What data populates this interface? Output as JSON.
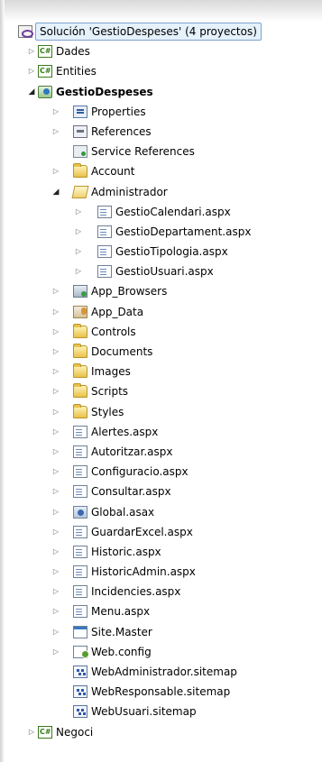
{
  "solution": {
    "label": "Solución 'GestioDespeses'  (4 proyectos)",
    "icon": "solution-icon"
  },
  "tree": [
    {
      "id": "dades",
      "label": "Dades",
      "level": 0,
      "arrow": "collapsed",
      "icon": "csharp-project-icon",
      "kind": "cs"
    },
    {
      "id": "entities",
      "label": "Entities",
      "level": 0,
      "arrow": "collapsed",
      "icon": "csharp-project-icon",
      "kind": "cs"
    },
    {
      "id": "gestiodespeses",
      "label": "GestioDespeses",
      "level": 0,
      "arrow": "expanded",
      "icon": "web-project-icon",
      "kind": "web",
      "bold": true
    },
    {
      "id": "properties",
      "label": "Properties",
      "level": 1,
      "arrow": "collapsed",
      "icon": "properties-icon",
      "kind": "props"
    },
    {
      "id": "references",
      "label": "References",
      "level": 1,
      "arrow": "collapsed",
      "icon": "references-icon",
      "kind": "refs"
    },
    {
      "id": "service-references",
      "label": "Service References",
      "level": 1,
      "arrow": "none",
      "icon": "service-references-icon",
      "kind": "svcref"
    },
    {
      "id": "account",
      "label": "Account",
      "level": 1,
      "arrow": "collapsed",
      "icon": "folder-icon",
      "kind": "folder"
    },
    {
      "id": "administrador",
      "label": "Administrador",
      "level": 1,
      "arrow": "expanded",
      "icon": "folder-open-icon",
      "kind": "folder-open"
    },
    {
      "id": "gestiocalendari",
      "label": "GestioCalendari.aspx",
      "level": 2,
      "arrow": "collapsed",
      "icon": "aspx-file-icon",
      "kind": "page"
    },
    {
      "id": "gestiodepartament",
      "label": "GestioDepartament.aspx",
      "level": 2,
      "arrow": "collapsed",
      "icon": "aspx-file-icon",
      "kind": "page"
    },
    {
      "id": "gestiotipologia",
      "label": "GestioTipologia.aspx",
      "level": 2,
      "arrow": "collapsed",
      "icon": "aspx-file-icon",
      "kind": "page"
    },
    {
      "id": "gestiousuari",
      "label": "GestioUsuari.aspx",
      "level": 2,
      "arrow": "collapsed",
      "icon": "aspx-file-icon",
      "kind": "page"
    },
    {
      "id": "app-browsers",
      "label": "App_Browsers",
      "level": 1,
      "arrow": "collapsed",
      "icon": "app-browsers-folder-icon",
      "kind": "appfolder"
    },
    {
      "id": "app-data",
      "label": "App_Data",
      "level": 1,
      "arrow": "collapsed",
      "icon": "app-data-folder-icon",
      "kind": "data"
    },
    {
      "id": "controls",
      "label": "Controls",
      "level": 1,
      "arrow": "collapsed",
      "icon": "folder-icon",
      "kind": "folder"
    },
    {
      "id": "documents",
      "label": "Documents",
      "level": 1,
      "arrow": "collapsed",
      "icon": "folder-icon",
      "kind": "folder"
    },
    {
      "id": "images",
      "label": "Images",
      "level": 1,
      "arrow": "collapsed",
      "icon": "folder-icon",
      "kind": "folder"
    },
    {
      "id": "scripts",
      "label": "Scripts",
      "level": 1,
      "arrow": "collapsed",
      "icon": "folder-icon",
      "kind": "folder"
    },
    {
      "id": "styles",
      "label": "Styles",
      "level": 1,
      "arrow": "collapsed",
      "icon": "folder-icon",
      "kind": "folder"
    },
    {
      "id": "alertes",
      "label": "Alertes.aspx",
      "level": 1,
      "arrow": "collapsed",
      "icon": "aspx-file-icon",
      "kind": "page"
    },
    {
      "id": "autoritzar",
      "label": "Autoritzar.aspx",
      "level": 1,
      "arrow": "collapsed",
      "icon": "aspx-file-icon",
      "kind": "page"
    },
    {
      "id": "configuracio",
      "label": "Configuracio.aspx",
      "level": 1,
      "arrow": "collapsed",
      "icon": "aspx-file-icon",
      "kind": "page"
    },
    {
      "id": "consultar",
      "label": "Consultar.aspx",
      "level": 1,
      "arrow": "collapsed",
      "icon": "aspx-file-icon",
      "kind": "page"
    },
    {
      "id": "global",
      "label": "Global.asax",
      "level": 1,
      "arrow": "collapsed",
      "icon": "global-asax-icon",
      "kind": "global"
    },
    {
      "id": "guardarexcel",
      "label": "GuardarExcel.aspx",
      "level": 1,
      "arrow": "collapsed",
      "icon": "aspx-file-icon",
      "kind": "page"
    },
    {
      "id": "historic",
      "label": "Historic.aspx",
      "level": 1,
      "arrow": "collapsed",
      "icon": "aspx-file-icon",
      "kind": "page"
    },
    {
      "id": "historicadmin",
      "label": "HistoricAdmin.aspx",
      "level": 1,
      "arrow": "collapsed",
      "icon": "aspx-file-icon",
      "kind": "page"
    },
    {
      "id": "incidencies",
      "label": "Incidencies.aspx",
      "level": 1,
      "arrow": "collapsed",
      "icon": "aspx-file-icon",
      "kind": "page"
    },
    {
      "id": "menu",
      "label": "Menu.aspx",
      "level": 1,
      "arrow": "collapsed",
      "icon": "aspx-file-icon",
      "kind": "page"
    },
    {
      "id": "site-master",
      "label": "Site.Master",
      "level": 1,
      "arrow": "collapsed",
      "icon": "master-page-icon",
      "kind": "master"
    },
    {
      "id": "web-config",
      "label": "Web.config",
      "level": 1,
      "arrow": "collapsed",
      "icon": "web-config-icon",
      "kind": "config"
    },
    {
      "id": "webadministrador",
      "label": "WebAdministrador.sitemap",
      "level": 1,
      "arrow": "none",
      "icon": "sitemap-icon",
      "kind": "sitemap"
    },
    {
      "id": "webresponsable",
      "label": "WebResponsable.sitemap",
      "level": 1,
      "arrow": "none",
      "icon": "sitemap-icon",
      "kind": "sitemap"
    },
    {
      "id": "webusuari",
      "label": "WebUsuari.sitemap",
      "level": 1,
      "arrow": "none",
      "icon": "sitemap-icon",
      "kind": "sitemap"
    },
    {
      "id": "negoci",
      "label": "Negoci",
      "level": 0,
      "arrow": "collapsed",
      "icon": "csharp-project-icon",
      "kind": "cs"
    }
  ],
  "colors": {
    "selection_bg": "#e5f1fb",
    "selection_border": "#7da2ce",
    "folder": "#e8c24a"
  }
}
